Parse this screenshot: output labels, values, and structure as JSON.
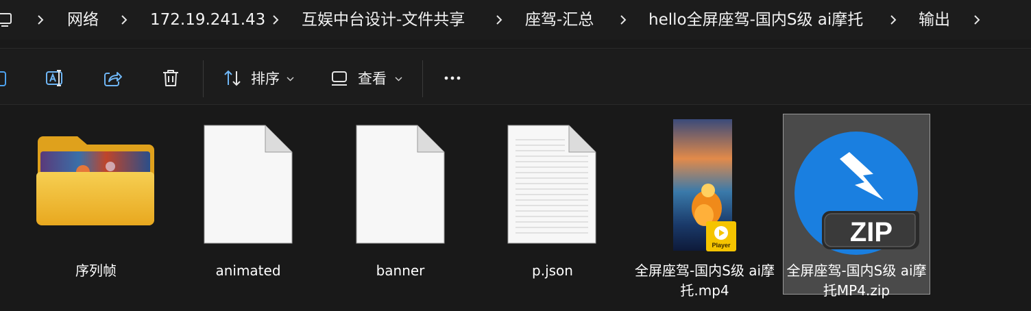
{
  "breadcrumb": {
    "items": [
      {
        "label": "网络"
      },
      {
        "label": "172.19.241.43"
      },
      {
        "label": "互娱中台设计-文件共享"
      },
      {
        "label": "座驾-汇总"
      },
      {
        "label": "hello全屏座驾-国内S级 ai摩托"
      },
      {
        "label": "输出"
      }
    ]
  },
  "toolbar": {
    "sort_label": "排序",
    "view_label": "查看",
    "icons": [
      "new-icon",
      "rename-icon",
      "share-icon",
      "delete-icon",
      "sort-icon",
      "view-icon",
      "more-icon"
    ]
  },
  "files": [
    {
      "name": "序列帧",
      "type": "folder",
      "selected": false
    },
    {
      "name": "animated",
      "type": "file",
      "selected": false
    },
    {
      "name": "banner",
      "type": "file",
      "selected": false
    },
    {
      "name": "p.json",
      "type": "text-file",
      "selected": false
    },
    {
      "name": "全屏座驾-国内S级 ai摩托.mp4",
      "type": "video",
      "badge": "Player",
      "selected": false
    },
    {
      "name": "全屏座驾-国内S级 ai摩托MP4.zip",
      "type": "zip",
      "badge": "ZIP",
      "selected": true
    }
  ],
  "colors": {
    "background": "#191919",
    "folder": "#f5c542",
    "zip_blue": "#1a7fe0",
    "selection": "#4a4a4a",
    "player_badge": "#f5c400"
  }
}
